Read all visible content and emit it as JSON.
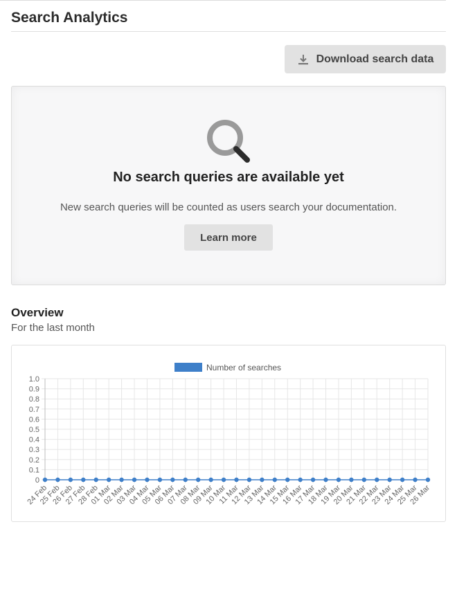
{
  "header": {
    "title": "Search Analytics"
  },
  "toolbar": {
    "download_label": "Download search data",
    "download_icon": "download-icon"
  },
  "empty_state": {
    "icon": "search-icon",
    "title": "No search queries are available yet",
    "description": "New search queries will be counted as users search your documentation.",
    "learn_more_label": "Learn more"
  },
  "overview": {
    "title": "Overview",
    "subtitle": "For the last month"
  },
  "colors": {
    "series": "#3e7fc9",
    "grid": "#e6e6e6",
    "button_bg": "#e2e2e2",
    "panel_bg": "#f7f7f8"
  },
  "chart_data": {
    "type": "line",
    "title": "",
    "xlabel": "",
    "ylabel": "",
    "ylim": [
      0,
      1
    ],
    "yticks": [
      "1.0",
      "0.9",
      "0.8",
      "0.7",
      "0.6",
      "0.5",
      "0.4",
      "0.3",
      "0.2",
      "0.1",
      "0"
    ],
    "grid": true,
    "legend_position": "top-center",
    "categories": [
      "24 Feb",
      "25 Feb",
      "26 Feb",
      "27 Feb",
      "28 Feb",
      "01 Mar",
      "02 Mar",
      "03 Mar",
      "04 Mar",
      "05 Mar",
      "06 Mar",
      "07 Mar",
      "08 Mar",
      "09 Mar",
      "10 Mar",
      "11 Mar",
      "12 Mar",
      "13 Mar",
      "14 Mar",
      "15 Mar",
      "16 Mar",
      "17 Mar",
      "18 Mar",
      "19 Mar",
      "20 Mar",
      "21 Mar",
      "22 Mar",
      "23 Mar",
      "24 Mar",
      "25 Mar",
      "26 Mar"
    ],
    "series": [
      {
        "name": "Number of searches",
        "color": "#3e7fc9",
        "values": [
          0,
          0,
          0,
          0,
          0,
          0,
          0,
          0,
          0,
          0,
          0,
          0,
          0,
          0,
          0,
          0,
          0,
          0,
          0,
          0,
          0,
          0,
          0,
          0,
          0,
          0,
          0,
          0,
          0,
          0,
          0
        ]
      }
    ]
  }
}
